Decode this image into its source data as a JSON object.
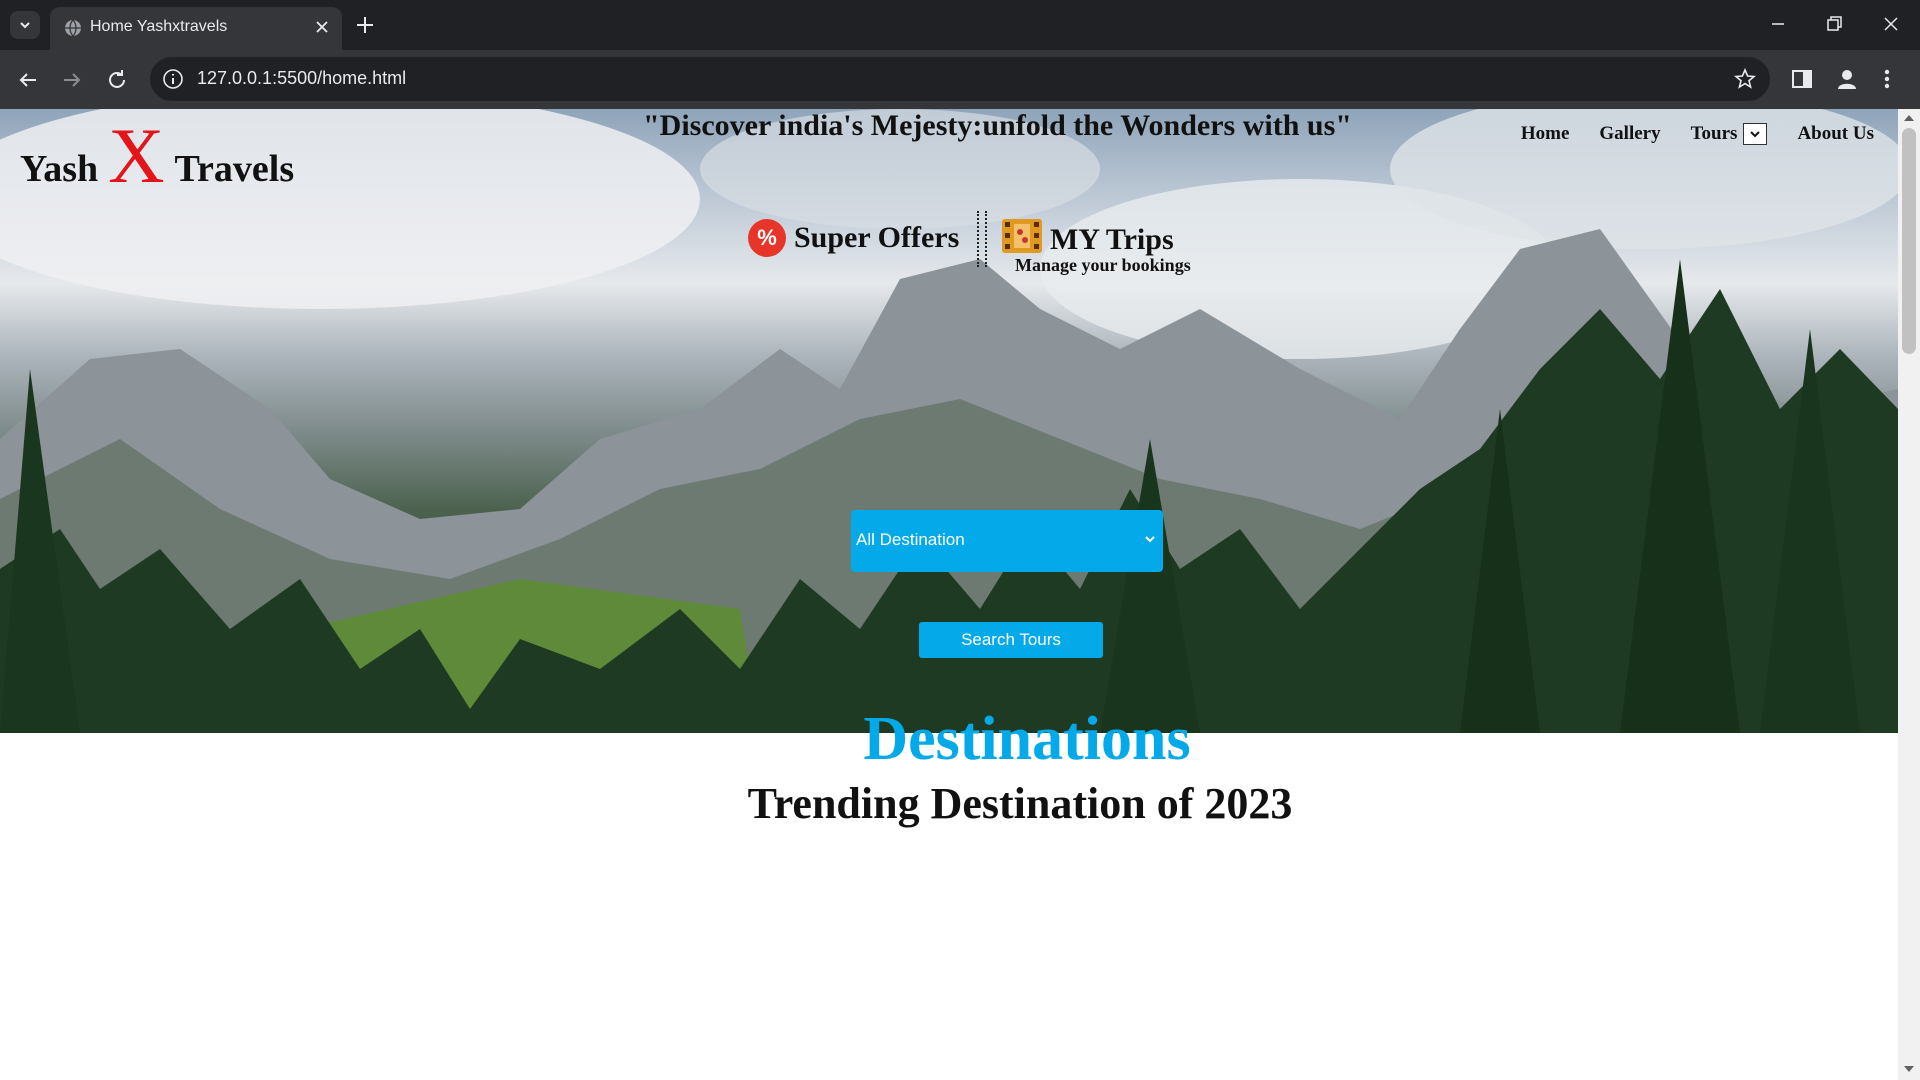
{
  "browser": {
    "tab_title": "Home Yashxtravels",
    "url": "127.0.0.1:5500/home.html"
  },
  "site": {
    "logo": {
      "word1": "Yash",
      "mark": "X",
      "word2": "Travels"
    },
    "tagline": "\"Discover india's Mejesty:unfold the Wonders with us\"",
    "nav": {
      "home": "Home",
      "gallery": "Gallery",
      "tours": "Tours",
      "about": "About Us"
    },
    "offers": {
      "label": "Super Offers",
      "icon": "percent-icon"
    },
    "trips": {
      "label": "MY Trips",
      "sublabel": "Manage your bookings",
      "icon": "film-icon"
    },
    "search": {
      "destination_selected": "All Destination",
      "button": "Search Tours"
    },
    "destinations": {
      "title": "Destinations",
      "subtitle": "Trending Destination of 2023"
    }
  },
  "colors": {
    "accent": "#03a9e9",
    "logo_x": "#e4141b",
    "offer_icon": "#e8352a"
  }
}
